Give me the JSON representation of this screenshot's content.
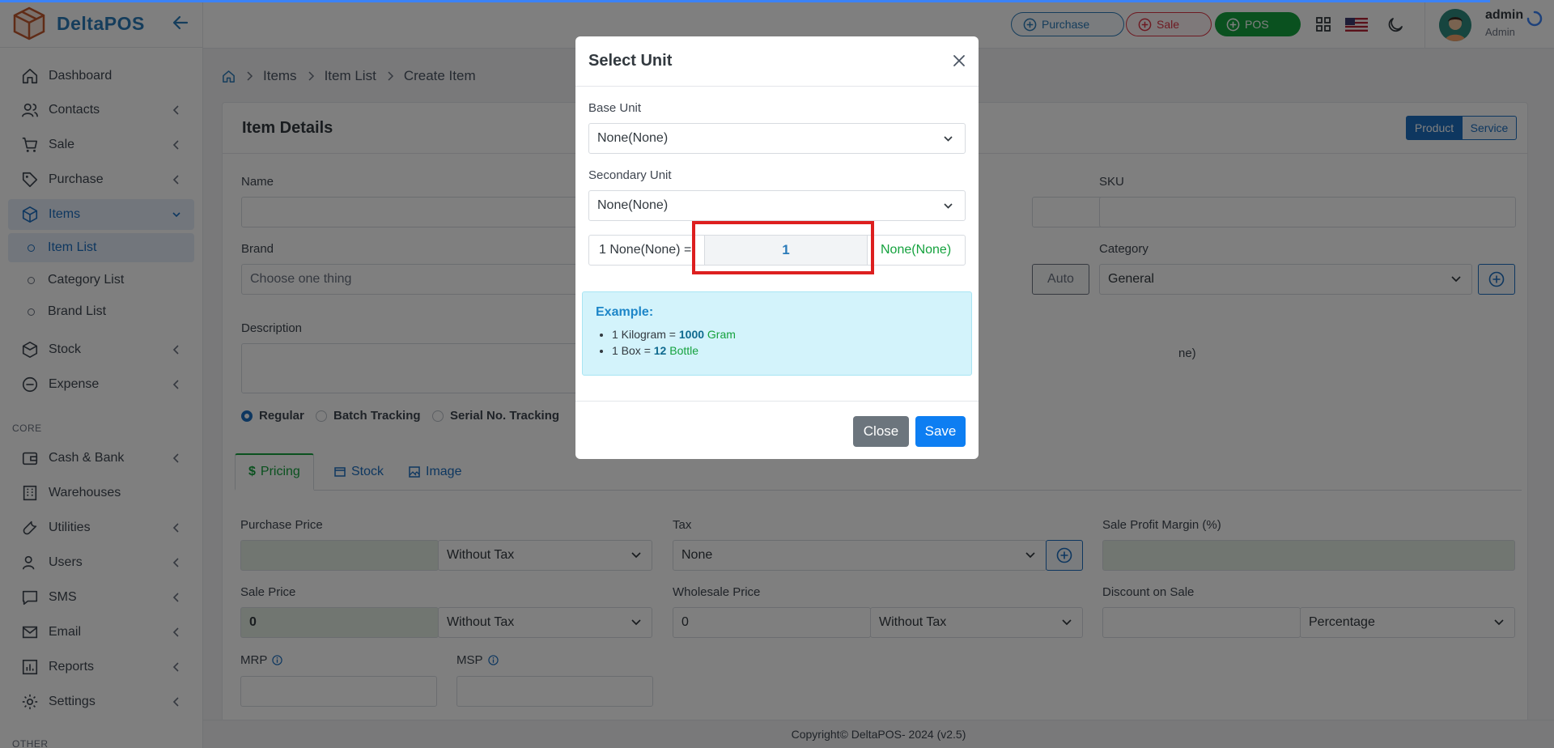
{
  "app": {
    "name": "DeltaPOS"
  },
  "sidebar": {
    "items": [
      {
        "label": "Dashboard"
      },
      {
        "label": "Contacts"
      },
      {
        "label": "Sale"
      },
      {
        "label": "Purchase"
      },
      {
        "label": "Items"
      },
      {
        "label": "Stock"
      },
      {
        "label": "Expense"
      },
      {
        "label": "Cash & Bank"
      },
      {
        "label": "Warehouses"
      },
      {
        "label": "Utilities"
      },
      {
        "label": "Users"
      },
      {
        "label": "SMS"
      },
      {
        "label": "Email"
      },
      {
        "label": "Reports"
      },
      {
        "label": "Settings"
      }
    ],
    "sub_items": [
      {
        "label": "Item List"
      },
      {
        "label": "Category List"
      },
      {
        "label": "Brand List"
      }
    ],
    "sections": {
      "core": "CORE",
      "other": "OTHER"
    }
  },
  "topbar": {
    "purchase_label": "Purchase",
    "sale_label": "Sale",
    "pos_label": "POS",
    "user_name": "admin",
    "user_role": "Admin"
  },
  "breadcrumb": [
    "Items",
    "Item List",
    "Create Item"
  ],
  "form": {
    "title": "Item Details",
    "type_options": [
      "Product",
      "Service"
    ],
    "name_label": "Name",
    "sku_label": "SKU",
    "brand_label": "Brand",
    "brand_placeholder": "Choose one thing",
    "auto_label": "Auto",
    "category_label": "Category",
    "category_value": "General",
    "description_label": "Description",
    "partial_text": "ne)",
    "tracking": [
      "Regular",
      "Batch Tracking",
      "Serial No. Tracking"
    ],
    "tabs": [
      "Pricing",
      "Stock",
      "Image"
    ],
    "purchase_price_label": "Purchase Price",
    "purchase_tax_type": "Without Tax",
    "tax_label": "Tax",
    "tax_value": "None",
    "sale_profit_label": "Sale Profit Margin (%)",
    "sale_price_label": "Sale Price",
    "sale_price_value": "0",
    "sale_tax_type": "Without Tax",
    "wholesale_label": "Wholesale Price",
    "wholesale_value": "0",
    "wholesale_tax_type": "Without Tax",
    "discount_label": "Discount on Sale",
    "discount_type": "Percentage",
    "mrp_label": "MRP",
    "msp_label": "MSP"
  },
  "footer": {
    "text": "Copyright© DeltaPOS- 2024 (v2.5)"
  },
  "modal": {
    "title": "Select Unit",
    "base_unit_label": "Base Unit",
    "base_unit_value": "None(None)",
    "secondary_unit_label": "Secondary Unit",
    "secondary_unit_value": "None(None)",
    "conversion_left": "1 None(None) =",
    "conversion_value": "1",
    "conversion_right": "None(None)",
    "example_title": "Example:",
    "examples": [
      {
        "prefix": "1 Kilogram =",
        "num": "1000",
        "unit": "Gram"
      },
      {
        "prefix": "1 Box =",
        "num": "12",
        "unit": "Bottle"
      }
    ],
    "close_label": "Close",
    "save_label": "Save"
  },
  "colors": {
    "primary": "#1d6fc0",
    "success": "#15a23e",
    "danger": "#dc3545",
    "highlight": "#dd1f1f"
  }
}
